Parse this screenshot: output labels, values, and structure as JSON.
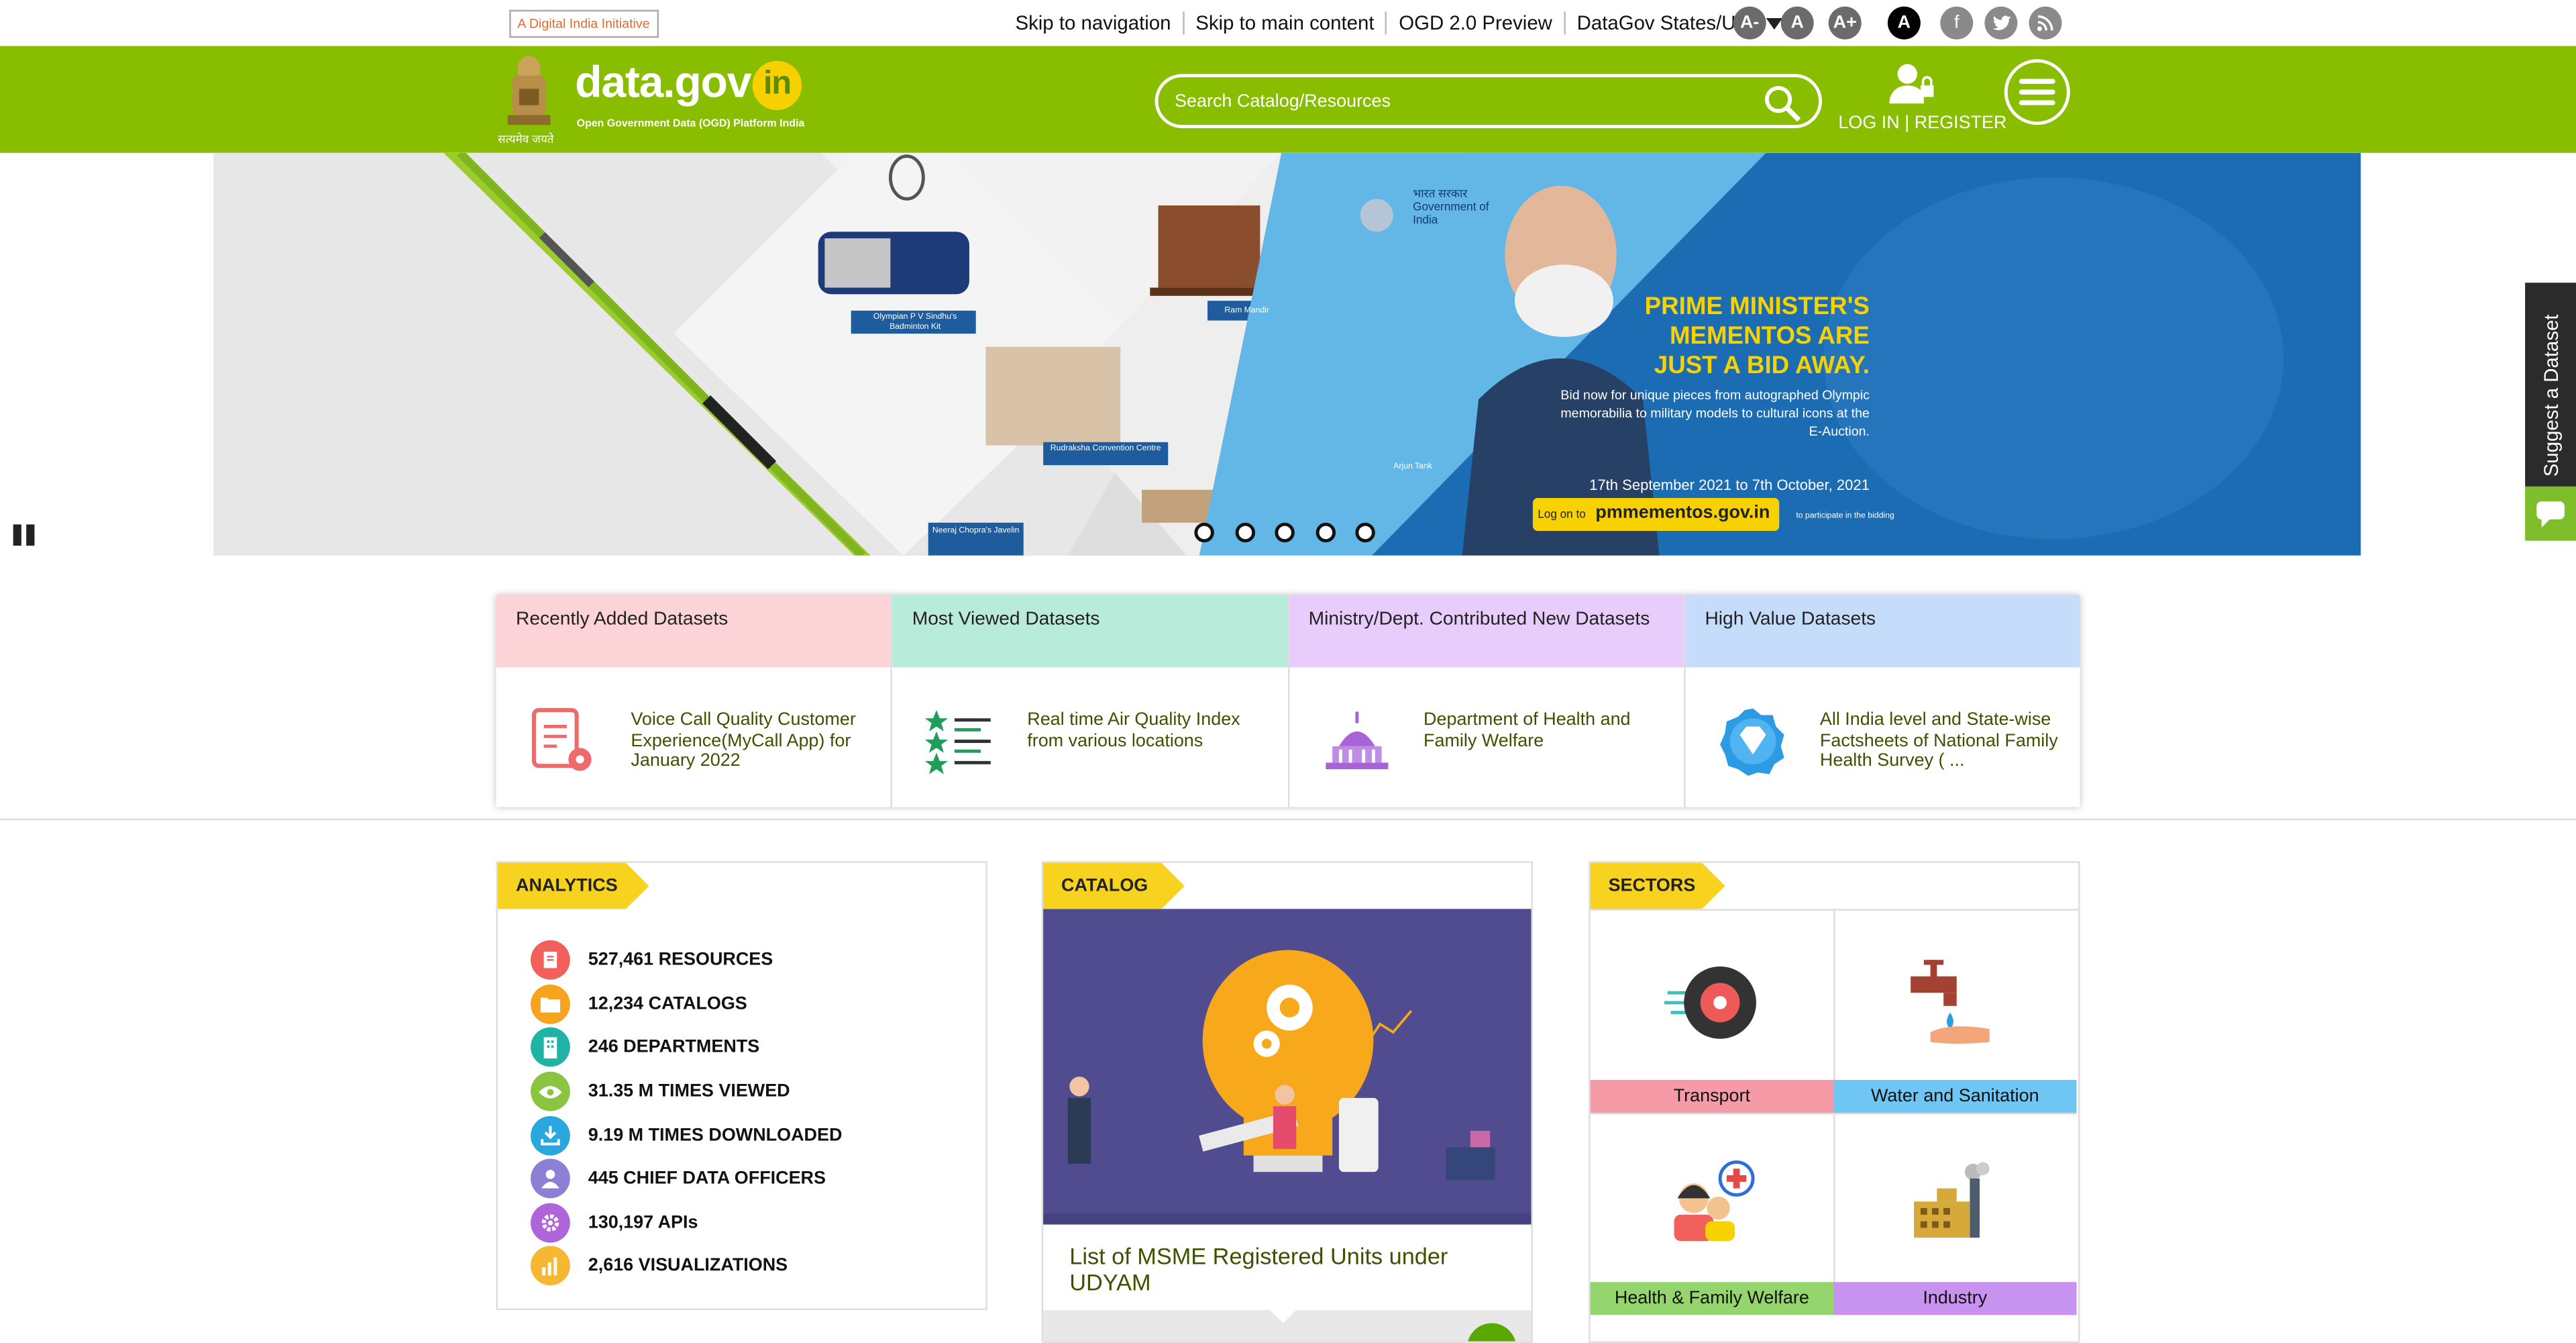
{
  "topbar": {
    "badge_text": "A Digital India Initiative",
    "links": [
      "Skip to navigation",
      "Skip to main content",
      "OGD 2.0 Preview",
      "DataGov States/ULB"
    ],
    "font_sizes": [
      "A-",
      "A",
      "A+"
    ],
    "contrast": "A"
  },
  "header": {
    "logo_main": "data.gov",
    "logo_in": "in",
    "logo_sub": "Open Government Data (OGD) Platform India",
    "emblem_caption": "सत्यमेव जयते",
    "search_placeholder": "Search Catalog/Resources",
    "login": "LOG IN",
    "separator": "|",
    "register": "REGISTER"
  },
  "banner": {
    "gov_label": "भारत सरकार Government of India",
    "headline": "PRIME MINISTER'S MEMENTOS ARE JUST A BID AWAY.",
    "subtext": "Bid now for unique pieces from autographed Olympic memorabilia to military models to cultural icons at the E-Auction.",
    "dates": "17th September 2021 to 7th October, 2021",
    "logon": "Log on to",
    "site": "pmmementos.gov.in",
    "participate": "to participate in the bidding",
    "captions": [
      "Olympian P V Sindhu's Badminton Kit",
      "Ram Mandir",
      "Rudraksha Convention Centre",
      "Arjun Tank",
      "Neeraj Chopra's Javelin"
    ],
    "slides": 5
  },
  "side_tab": {
    "label": "Suggest a Dataset"
  },
  "cards": [
    {
      "header": "Recently Added Datasets",
      "text": "Voice Call Quality Customer Experience(MyCall App) for January 2022",
      "icon": "document-gear-icon",
      "bg": "#fcd3d6"
    },
    {
      "header": "Most Viewed Datasets",
      "text": "Real time Air Quality Index from various locations",
      "icon": "star-list-icon",
      "bg": "#b8ebd9"
    },
    {
      "header": "Ministry/Dept. Contributed New Datasets",
      "text": "Department of Health and Family Welfare",
      "icon": "parliament-icon",
      "bg": "#e8ccfb"
    },
    {
      "header": "High Value Datasets",
      "text": "All India level and State-wise Factsheets of National Family Health Survey ( ...",
      "icon": "diamond-badge-icon",
      "bg": "#c6dcfb"
    }
  ],
  "analytics": {
    "title": "ANALYTICS",
    "stats": [
      {
        "text": "527,461 RESOURCES",
        "icon": "resources-icon",
        "color": "#f1605b"
      },
      {
        "text": "12,234 CATALOGS",
        "icon": "folder-icon",
        "color": "#f6a31e"
      },
      {
        "text": "246 DEPARTMENTS",
        "icon": "building-icon",
        "color": "#1fb3a5"
      },
      {
        "text": "31.35 M TIMES VIEWED",
        "icon": "eye-icon",
        "color": "#8bc53f"
      },
      {
        "text": "9.19 M TIMES DOWNLOADED",
        "icon": "download-icon",
        "color": "#29a8e0"
      },
      {
        "text": "445 CHIEF DATA OFFICERS",
        "icon": "person-icon",
        "color": "#8c7fd6"
      },
      {
        "text": "130,197 APIs",
        "icon": "gear-icon",
        "color": "#b064d9"
      },
      {
        "text": "2,616 VISUALIZATIONS",
        "icon": "bar-chart-icon",
        "color": "#f7b733"
      }
    ]
  },
  "catalog": {
    "title": "CATALOG",
    "item_title": "List of MSME Registered Units under UDYAM"
  },
  "sectors": {
    "title": "SECTORS",
    "items": [
      {
        "label": "Transport",
        "color": "#f59aa6",
        "icon": "wheel-icon"
      },
      {
        "label": "Water and Sanitation",
        "color": "#6fc6f4",
        "icon": "tap-icon"
      },
      {
        "label": "Health & Family Welfare",
        "color": "#95d56e",
        "icon": "family-health-icon"
      },
      {
        "label": "Industry",
        "color": "#c792f0",
        "icon": "factory-icon"
      }
    ]
  }
}
